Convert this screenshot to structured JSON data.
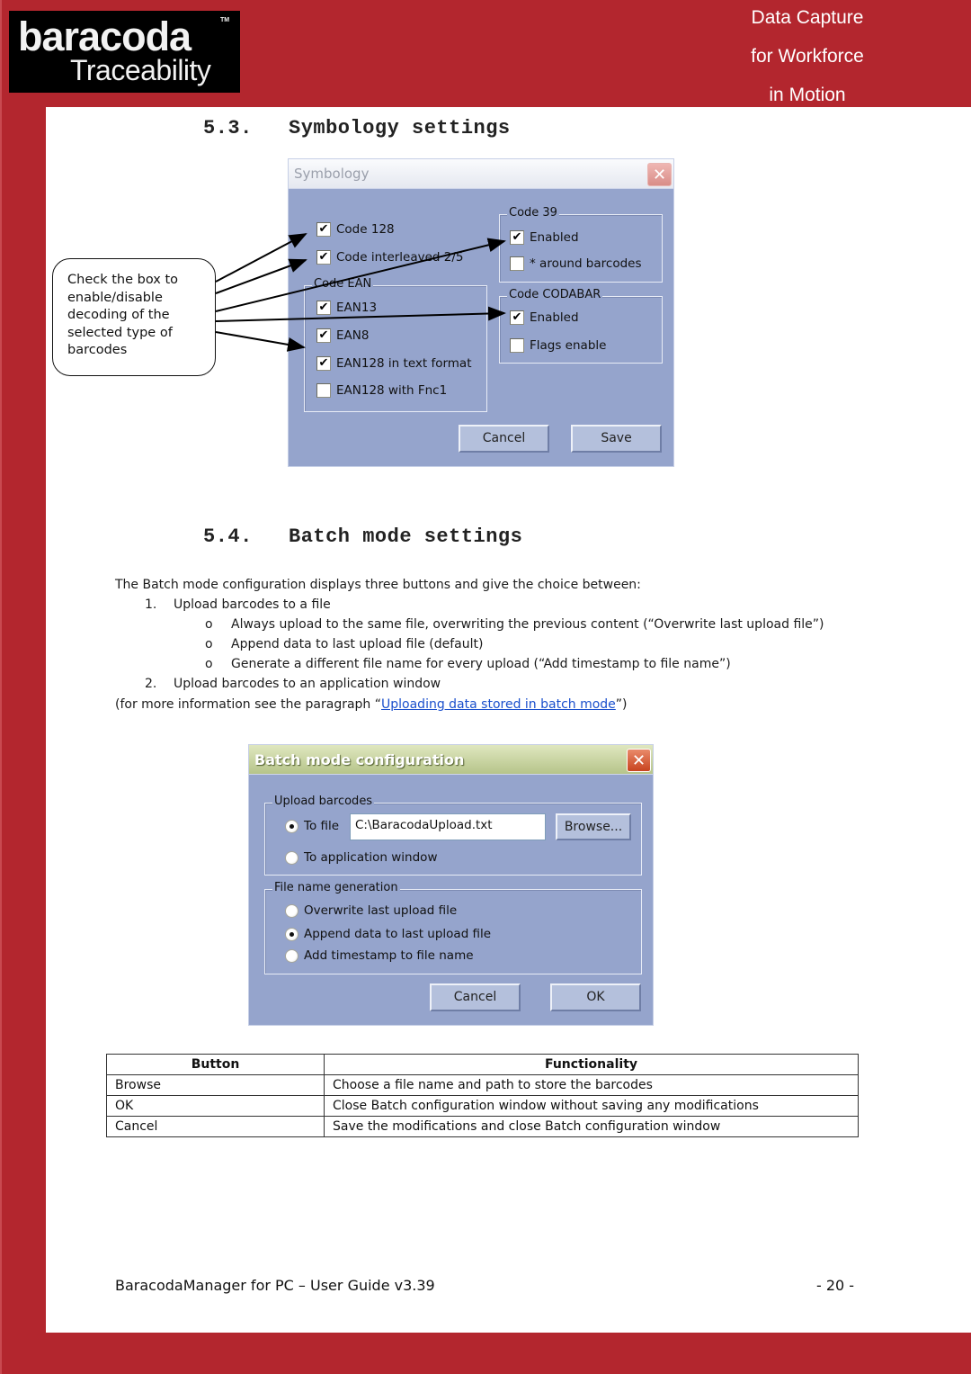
{
  "header": {
    "logo_brand": "baracoda",
    "logo_tm": "TM",
    "logo_sub": "Traceability",
    "tagline": [
      "Data Capture",
      "for Workforce",
      "in Motion"
    ],
    "colors": {
      "brand_red": "#b3262e",
      "dialog_blue": "#95a4cc"
    }
  },
  "section_symbology": {
    "number": "5.3.",
    "title": "Symbology settings",
    "callout_text": "Check the box to enable/disable decoding of the selected type of barcodes",
    "dialog": {
      "title": "Symbology",
      "close_icon": "close-icon",
      "standalone": [
        {
          "label": "Code 128",
          "checked": true
        },
        {
          "label": "Code interleaved 2/5",
          "checked": true
        }
      ],
      "group_ean": {
        "legend": "Code EAN",
        "items": [
          {
            "label": "EAN13",
            "checked": true
          },
          {
            "label": "EAN8",
            "checked": true
          },
          {
            "label": "EAN128 in text format",
            "checked": true
          },
          {
            "label": "EAN128 with Fnc1",
            "checked": false
          }
        ]
      },
      "group_code39": {
        "legend": "Code 39",
        "items": [
          {
            "label": "Enabled",
            "checked": true
          },
          {
            "label": "* around barcodes",
            "checked": false
          }
        ]
      },
      "group_codabar": {
        "legend": "Code CODABAR",
        "items": [
          {
            "label": "Enabled",
            "checked": true
          },
          {
            "label": "Flags enable",
            "checked": false
          }
        ]
      },
      "cancel_label": "Cancel",
      "save_label": "Save"
    }
  },
  "section_batch": {
    "number": "5.4.",
    "title": "Batch mode settings",
    "intro": "The Batch mode configuration displays three buttons and give the choice between:",
    "list": [
      {
        "marker": "1.",
        "text": "Upload barcodes to a file"
      },
      {
        "marker": "o",
        "text": "Always upload to the same file, overwriting the previous content (“Overwrite last upload file”)"
      },
      {
        "marker": "o",
        "text": "Append data to last upload file (default)"
      },
      {
        "marker": "o",
        "text": "Generate a different file name for every upload (“Add timestamp to file name”)"
      },
      {
        "marker": "2.",
        "text": "Upload barcodes to an application window"
      }
    ],
    "more_info_prefix": "(for more information see the paragraph “",
    "more_info_link": "Uploading data stored in batch mode",
    "more_info_suffix": "”)",
    "dialog": {
      "title": "Batch mode configuration",
      "group_upload": {
        "legend": "Upload barcodes",
        "to_file_label": "To file",
        "to_file_selected": true,
        "file_path": "C:\\BaracodaUpload.txt",
        "browse_label": "Browse...",
        "to_app_label": "To application window",
        "to_app_selected": false
      },
      "group_filename": {
        "legend": "File name generation",
        "options": [
          {
            "label": "Overwrite last upload file",
            "selected": false
          },
          {
            "label": "Append data to last upload file",
            "selected": true
          },
          {
            "label": "Add timestamp to file name",
            "selected": false
          }
        ]
      },
      "cancel_label": "Cancel",
      "ok_label": "OK"
    },
    "table": {
      "headers": [
        "Button",
        "Functionality"
      ],
      "rows": [
        [
          "Browse",
          "Choose a file name and path to store the barcodes"
        ],
        [
          "OK",
          "Close Batch configuration window without saving any modifications"
        ],
        [
          "Cancel",
          "Save the modifications and close Batch configuration window"
        ]
      ]
    }
  },
  "footer": {
    "doc_title": "BaracodaManager for PC – User Guide v3.39",
    "page_number": "- 20 -"
  }
}
